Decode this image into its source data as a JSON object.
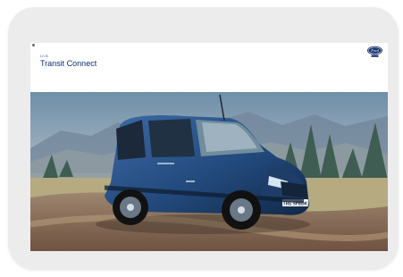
{
  "page": {
    "eyebrow": "Lit B",
    "title": "Transit Connect"
  },
  "brand": {
    "logo_alt": "Ford logo",
    "logo_text": "Ford",
    "color": "#17336e"
  },
  "hero": {
    "image_alt": "Blue Ford Transit Connect driving on a dirt road",
    "plate_text": "TRE 5FEDK",
    "vehicle_color": "#294f86"
  }
}
